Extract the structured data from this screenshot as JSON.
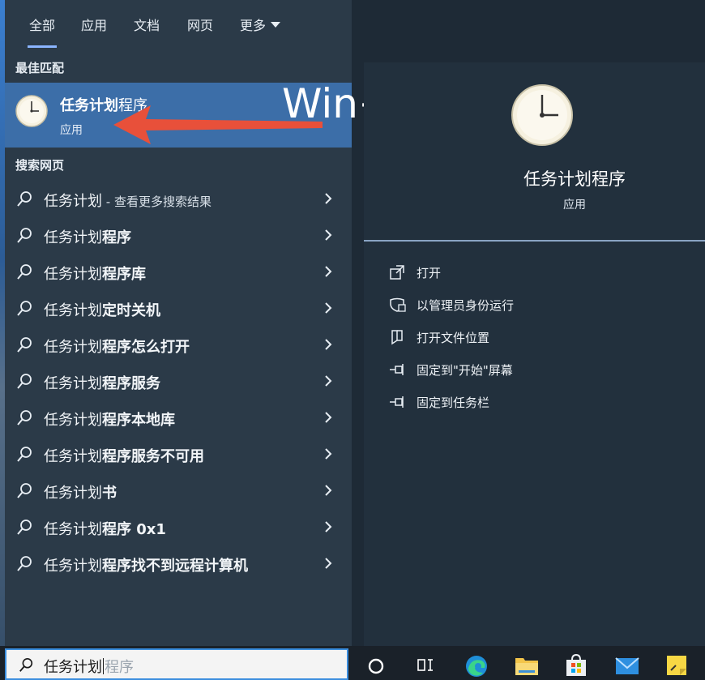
{
  "tabs": [
    {
      "label": "全部",
      "active": true
    },
    {
      "label": "应用"
    },
    {
      "label": "文档"
    },
    {
      "label": "网页"
    },
    {
      "label": "更多"
    }
  ],
  "best_match": {
    "section_title": "最佳匹配",
    "name_bold": "任务计划",
    "name_rest": "程序",
    "type": "应用"
  },
  "annotation": "Win+s搜索",
  "web_search": {
    "section_title": "搜索网页",
    "items": [
      {
        "prefix": "任务计划",
        "highlight": "",
        "suffix": " - 查看更多搜索结果"
      },
      {
        "prefix": "任务计划",
        "highlight": "程序",
        "suffix": ""
      },
      {
        "prefix": "任务计划",
        "highlight": "程序库",
        "suffix": ""
      },
      {
        "prefix": "任务计划",
        "highlight": "定时关机",
        "suffix": ""
      },
      {
        "prefix": "任务计划",
        "highlight": "程序怎么打开",
        "suffix": ""
      },
      {
        "prefix": "任务计划",
        "highlight": "程序服务",
        "suffix": ""
      },
      {
        "prefix": "任务计划",
        "highlight": "程序本地库",
        "suffix": ""
      },
      {
        "prefix": "任务计划",
        "highlight": "程序服务不可用",
        "suffix": ""
      },
      {
        "prefix": "任务计划",
        "highlight": "书",
        "suffix": ""
      },
      {
        "prefix": "任务计划",
        "highlight": "程序 0x1",
        "suffix": ""
      },
      {
        "prefix": "任务计划",
        "highlight": "程序找不到远程计算机",
        "suffix": ""
      }
    ]
  },
  "detail": {
    "title": "任务计划程序",
    "subtitle": "应用",
    "actions": [
      {
        "label": "打开",
        "icon": "open-icon"
      },
      {
        "label": "以管理员身份运行",
        "icon": "shield-icon"
      },
      {
        "label": "打开文件位置",
        "icon": "file-location-icon"
      },
      {
        "label": "固定到\"开始\"屏幕",
        "icon": "pin-icon"
      },
      {
        "label": "固定到任务栏",
        "icon": "pin-icon"
      }
    ]
  },
  "search": {
    "typed": "任务计划",
    "ghost": "程序"
  },
  "colors": {
    "accent": "#3b8ede",
    "selected_bg": "#3c6ea8",
    "panel_bg": "#2b3a48",
    "arrow": "#e8503a"
  }
}
